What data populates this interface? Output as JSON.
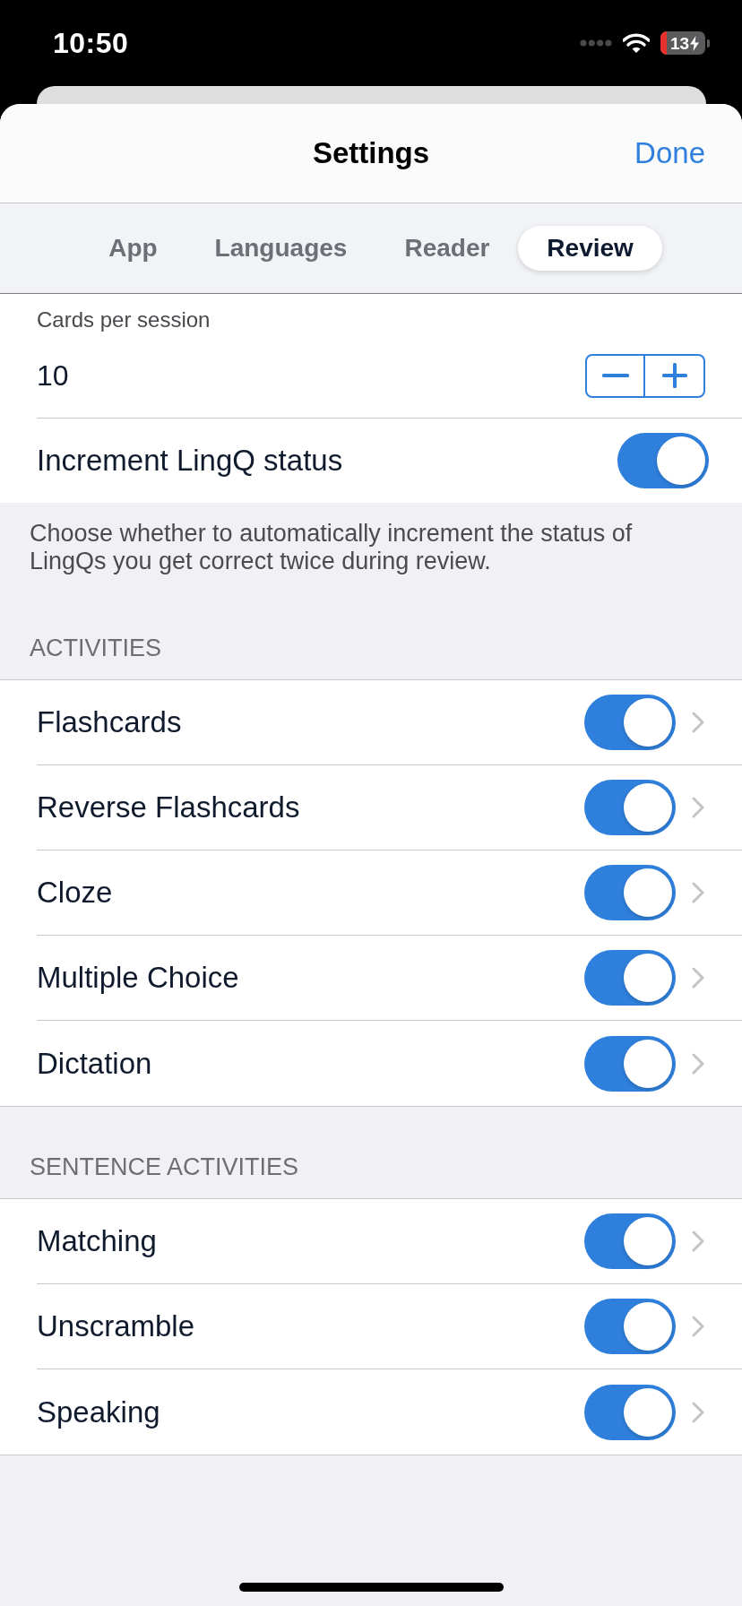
{
  "status_bar": {
    "time": "10:50",
    "battery": "13"
  },
  "header": {
    "title": "Settings",
    "done": "Done"
  },
  "tabs": [
    {
      "label": "App",
      "selected": false
    },
    {
      "label": "Languages",
      "selected": false
    },
    {
      "label": "Reader",
      "selected": false
    },
    {
      "label": "Review",
      "selected": true
    }
  ],
  "cards_per_session": {
    "label": "Cards per session",
    "value": "10"
  },
  "increment_status": {
    "label": "Increment LingQ status",
    "on": true,
    "footer": "Choose whether to automatically increment the status of LingQs you get correct twice during review."
  },
  "sections": [
    {
      "header": "ACTIVITIES",
      "items": [
        {
          "label": "Flashcards",
          "on": true
        },
        {
          "label": "Reverse Flashcards",
          "on": true
        },
        {
          "label": "Cloze",
          "on": true
        },
        {
          "label": "Multiple Choice",
          "on": true
        },
        {
          "label": "Dictation",
          "on": true
        }
      ]
    },
    {
      "header": "SENTENCE ACTIVITIES",
      "items": [
        {
          "label": "Matching",
          "on": true
        },
        {
          "label": "Unscramble",
          "on": true
        },
        {
          "label": "Speaking",
          "on": true
        }
      ]
    }
  ]
}
